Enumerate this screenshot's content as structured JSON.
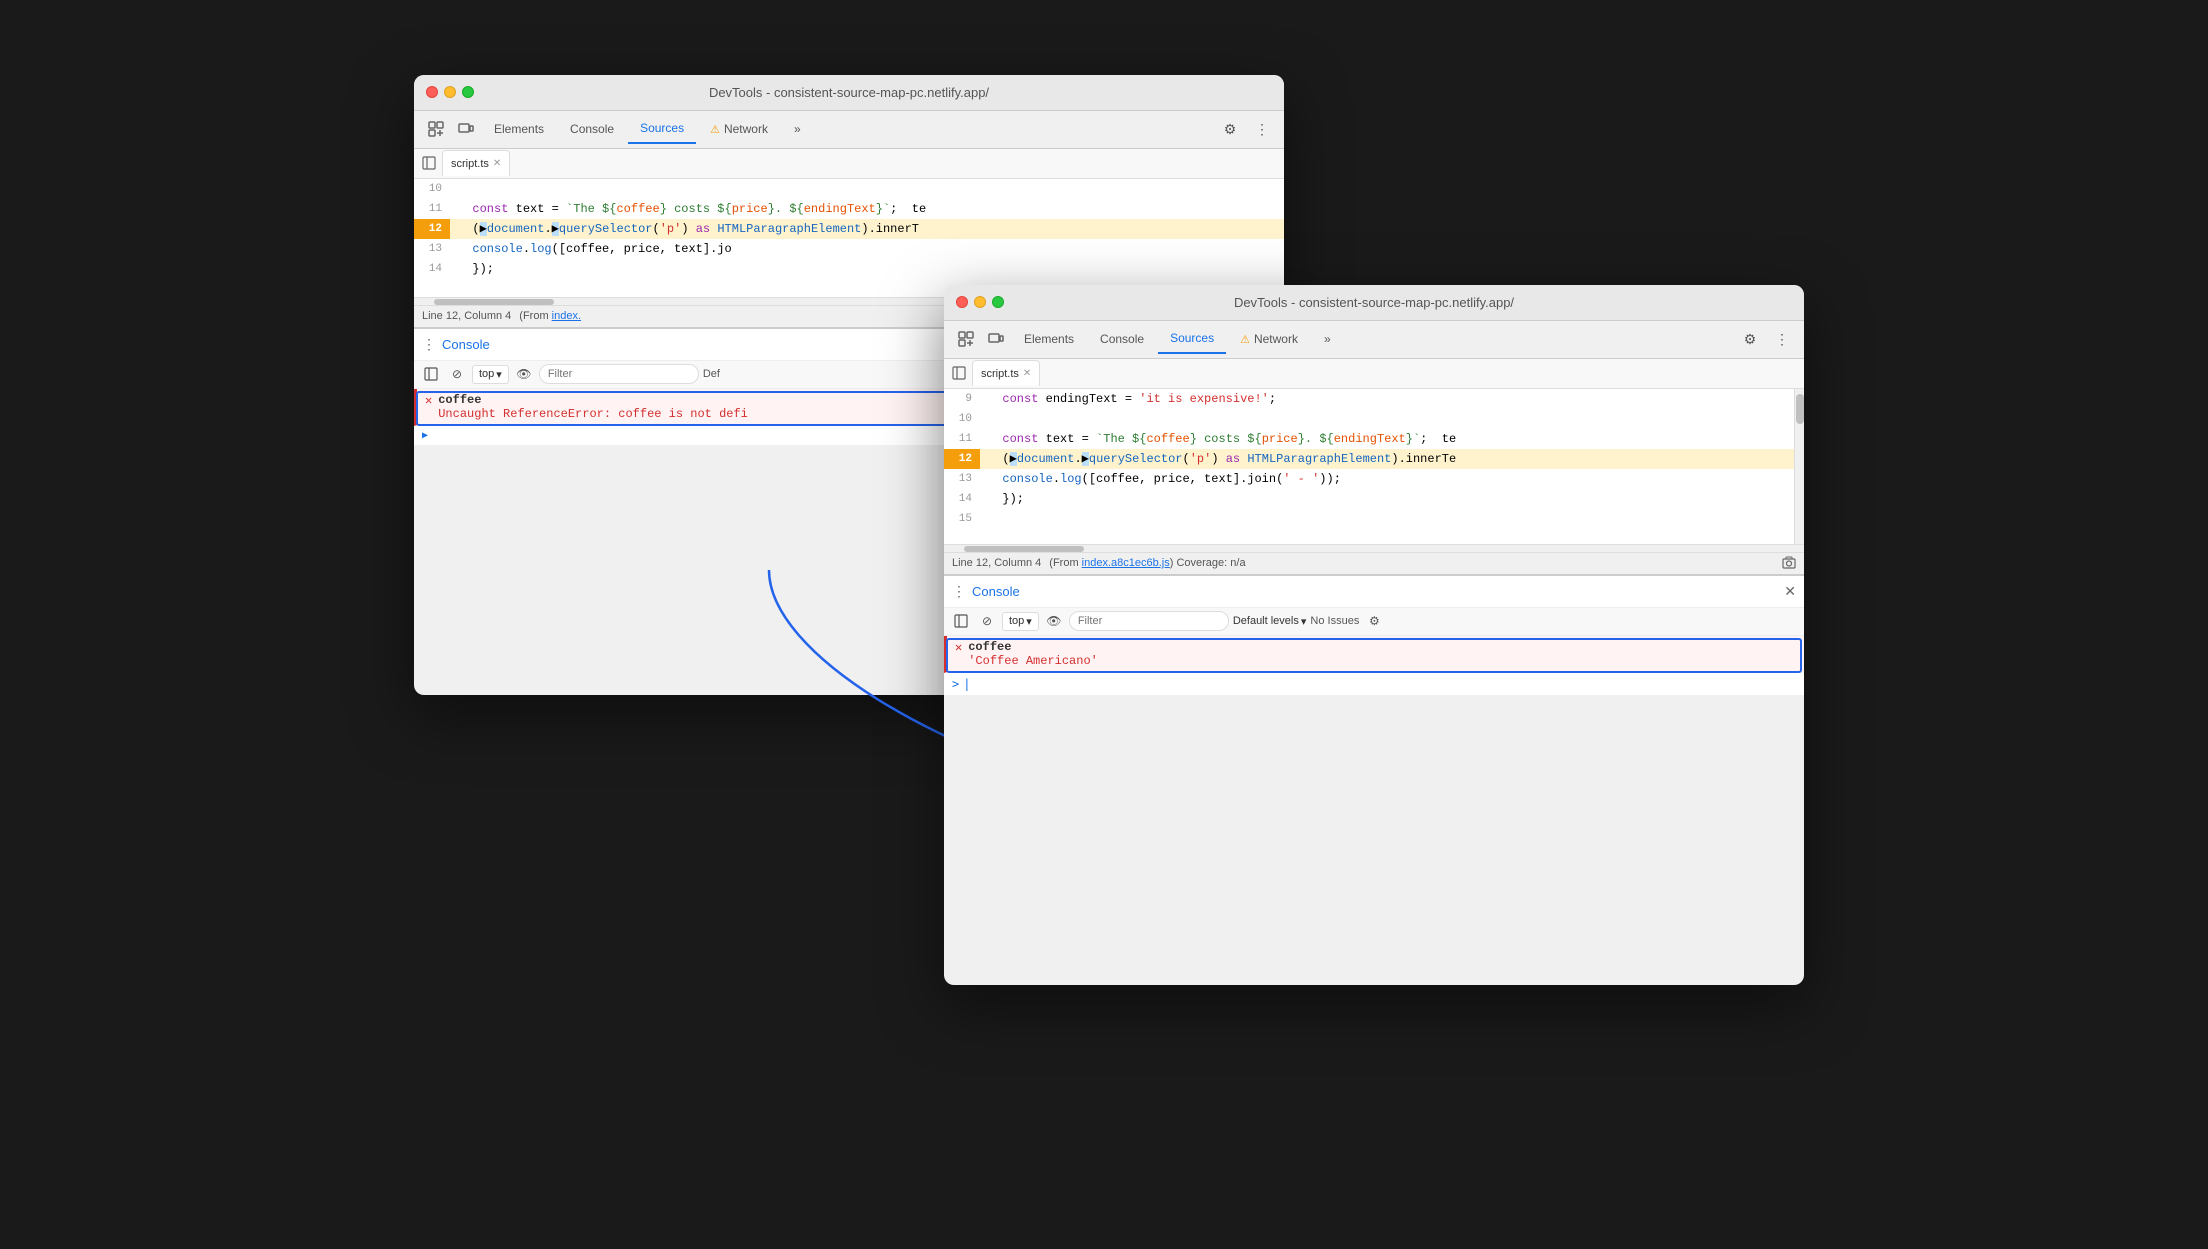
{
  "scene": {
    "background": "#1a1a1a"
  },
  "window_back": {
    "title": "DevTools - consistent-source-map-pc.netlify.app/",
    "tabs": [
      "Elements",
      "Console",
      "Sources",
      "Network"
    ],
    "active_tab": "Sources",
    "file_tab": "script.ts",
    "code_lines": [
      {
        "num": "10",
        "content": "",
        "highlighted": false
      },
      {
        "num": "11",
        "content": "  const text = `The ${coffee} costs ${price}. ${endingText}`;  te",
        "highlighted": false
      },
      {
        "num": "12",
        "content": "  (document.querySelector('p') as HTMLParagraphElement).innerT",
        "highlighted": true
      },
      {
        "num": "13",
        "content": "  console.log([coffee, price, text].jo",
        "highlighted": false
      },
      {
        "num": "14",
        "content": "  });",
        "highlighted": false
      }
    ],
    "status_line": "Line 12, Column 4",
    "status_from": "(From index.",
    "console_title": "Console",
    "top_label": "top",
    "filter_placeholder": "Filter",
    "def_levels": "Def",
    "error_name": "coffee",
    "error_msg": "Uncaught ReferenceError: coffee is not defi"
  },
  "window_front": {
    "title": "DevTools - consistent-source-map-pc.netlify.app/",
    "tabs": [
      "Elements",
      "Console",
      "Sources",
      "Network"
    ],
    "active_tab": "Sources",
    "file_tab": "script.ts",
    "code_lines": [
      {
        "num": "9",
        "content": "  const endingText = 'it is expensive!';",
        "highlighted": false
      },
      {
        "num": "10",
        "content": "",
        "highlighted": false
      },
      {
        "num": "11",
        "content": "  const text = `The ${coffee} costs ${price}. ${endingText}`;  te",
        "highlighted": false
      },
      {
        "num": "12",
        "content": "  (document.querySelector('p') as HTMLParagraphElement).innerTe",
        "highlighted": true
      },
      {
        "num": "13",
        "content": "  console.log([coffee, price, text].join(' - '));",
        "highlighted": false
      },
      {
        "num": "14",
        "content": "  });",
        "highlighted": false
      },
      {
        "num": "15",
        "content": "",
        "highlighted": false
      }
    ],
    "status_line": "Line 12, Column 4",
    "status_from": "(From index.a8c1ec6b.js)",
    "status_coverage": "Coverage: n/a",
    "console_title": "Console",
    "top_label": "top",
    "filter_placeholder": "Filter",
    "default_levels": "Default levels",
    "no_issues": "No Issues",
    "error_name": "coffee",
    "coffee_value": "'Coffee Americano'",
    "prompt_symbol": ">",
    "cursor": "|"
  },
  "icons": {
    "close": "✕",
    "expand": "▶",
    "chevron_down": "▾",
    "more_vert": "⋮",
    "settings": "⚙",
    "more_horiz": "›",
    "double_arrow": "≫",
    "sidebar": "⊡",
    "frame": "⊡",
    "ban": "⊘",
    "eye": "👁",
    "warning": "⚠"
  }
}
